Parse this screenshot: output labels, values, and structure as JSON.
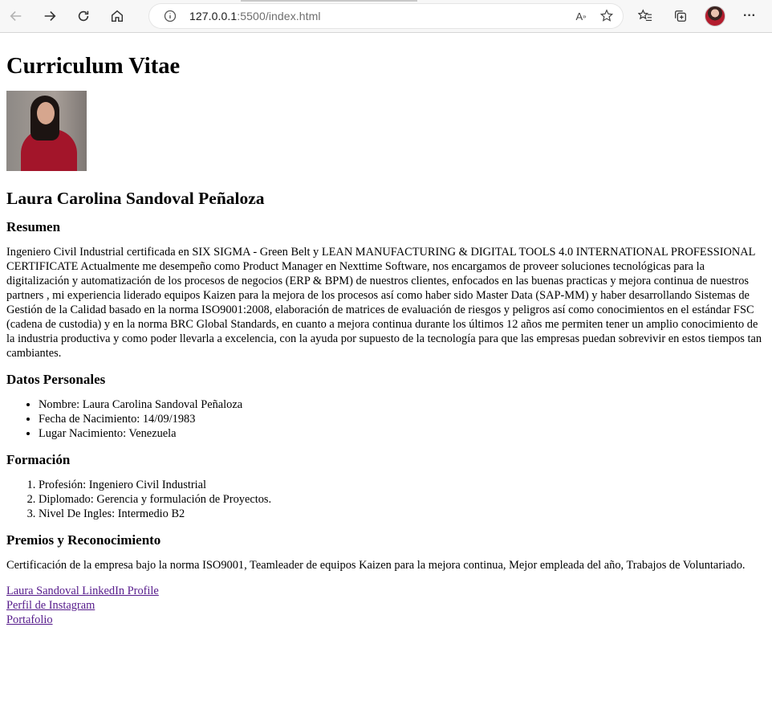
{
  "browser": {
    "url_host": "127.0.0.1",
    "url_rest": ":5500/index.html"
  },
  "page": {
    "title": "Curriculum Vitae",
    "name": "Laura Carolina Sandoval Peñaloza",
    "resumen_heading": "Resumen",
    "resumen_text": "Ingeniero Civil Industrial certificada en SIX SIGMA - Green Belt y LEAN MANUFACTURING & DIGITAL TOOLS 4.0 INTERNATIONAL PROFESSIONAL CERTIFICATE Actualmente me desempeño como Product Manager en Nexttime Software, nos encargamos de proveer soluciones tecnológicas para la digitalización y automatización de los procesos de negocios (ERP & BPM) de nuestros clientes, enfocados en las buenas practicas y mejora continua de nuestros partners , mi experiencia liderado equipos Kaizen para la mejora de los procesos así como haber sido Master Data (SAP-MM) y haber desarrollando Sistemas de Gestión de la Calidad basado en la norma ISO9001:2008, elaboración de matrices de evaluación de riesgos y peligros así como conocimientos en el estándar FSC (cadena de custodia) y en la norma BRC Global Standards, en cuanto a mejora continua durante los últimos 12 años me permiten tener un amplio conocimiento de la industria productiva y como poder llevarla a excelencia, con la ayuda por supuesto de la tecnología para que las empresas puedan sobrevivir en estos tiempos tan cambiantes.",
    "datos_heading": "Datos Personales",
    "datos_items": [
      "Nombre: Laura Carolina Sandoval Peñaloza",
      "Fecha de Nacimiento: 14/09/1983",
      "Lugar Nacimiento: Venezuela"
    ],
    "formacion_heading": "Formación",
    "formacion_items": [
      "Profesión: Ingeniero Civil Industrial",
      "Diplomado: Gerencia y formulación de Proyectos.",
      "Nivel De Ingles: Intermedio B2"
    ],
    "premios_heading": "Premios y Reconocimiento",
    "premios_text": "Certificación de la empresa bajo la norma ISO9001, Teamleader de equipos Kaizen para la mejora continua, Mejor empleada del año, Trabajos de Voluntariado.",
    "links": [
      "Laura Sandoval LinkedIn Profile",
      "Perfil de Instagram",
      "Portafolio"
    ]
  }
}
